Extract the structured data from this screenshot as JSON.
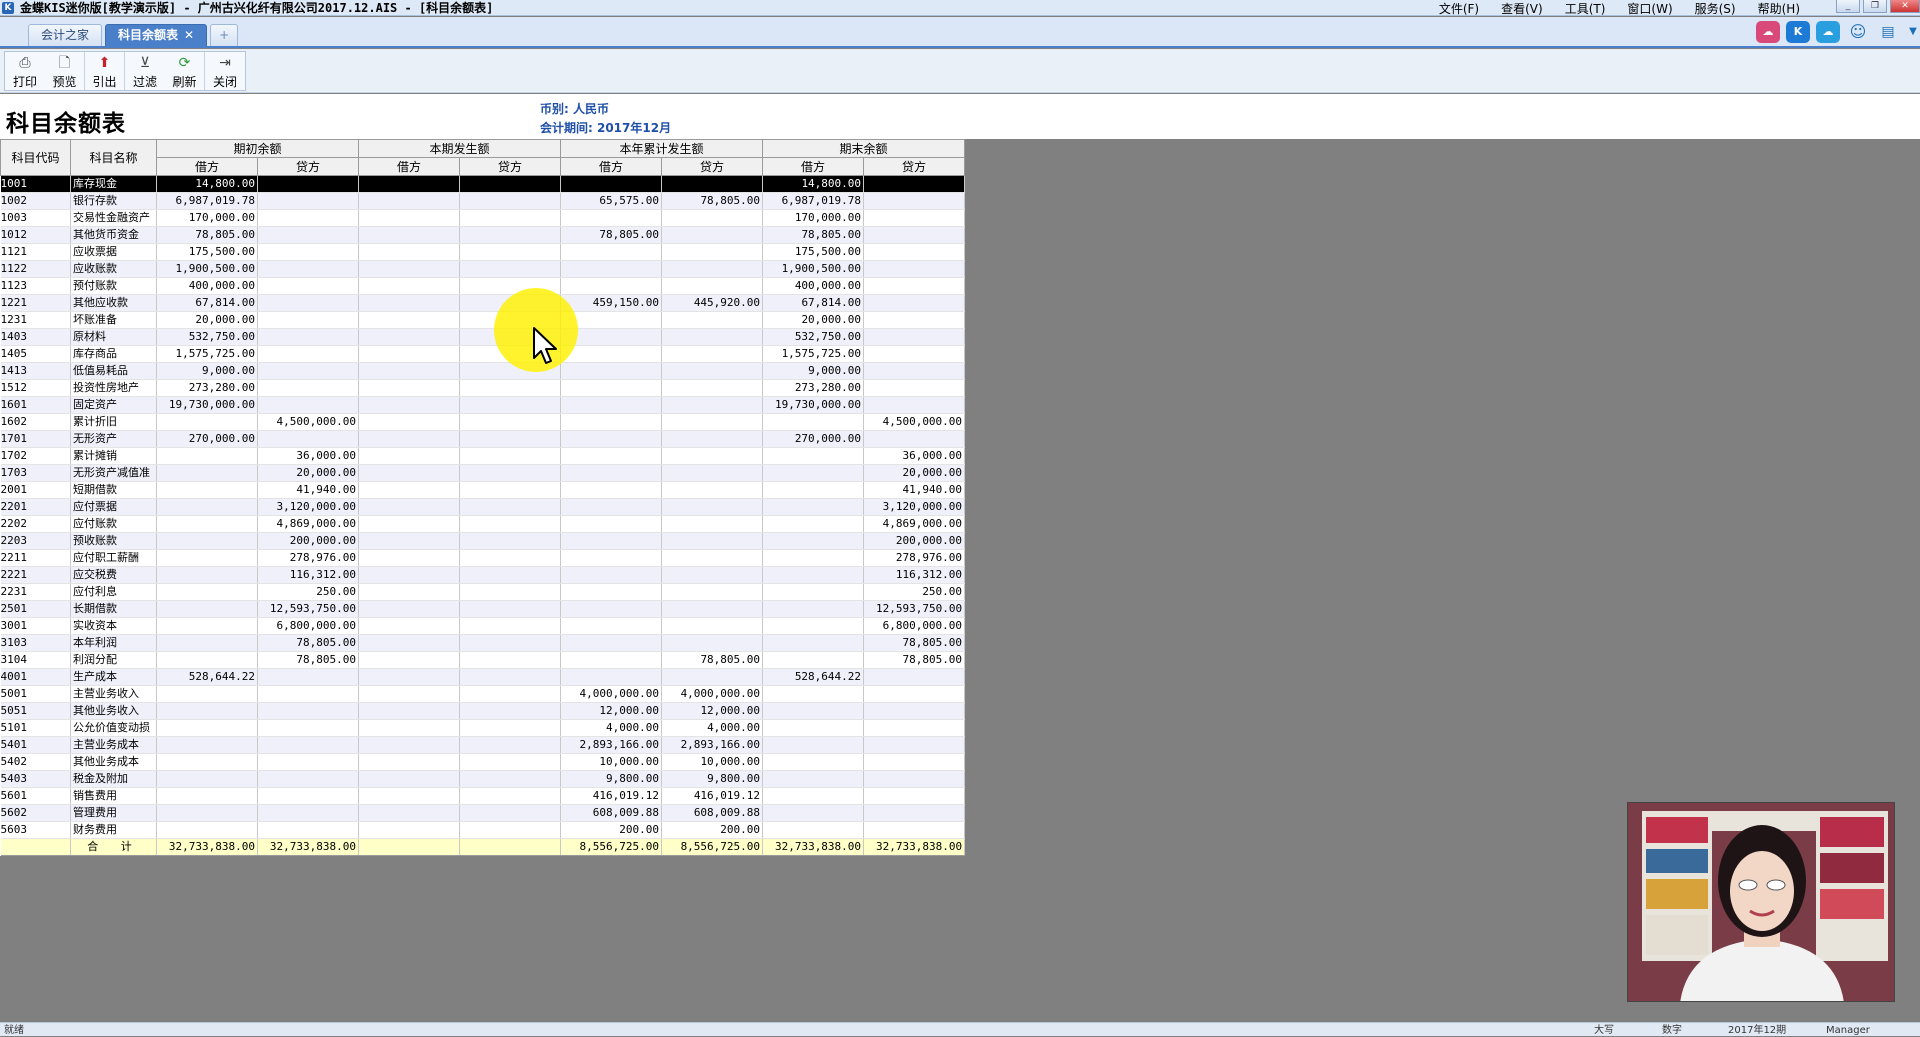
{
  "window": {
    "title": "金蝶KIS迷你版[教学演示版] - 广州古兴化纤有限公司2017.12.AIS - [科目余额表]",
    "menus": [
      "文件(F)",
      "查看(V)",
      "工具(T)",
      "窗口(W)",
      "服务(S)",
      "帮助(H)"
    ]
  },
  "tabs": [
    {
      "label": "会计之家",
      "active": false
    },
    {
      "label": "科目余额表",
      "active": true,
      "close": "✕"
    }
  ],
  "tab_add": "+",
  "toolbar": {
    "print": "打印",
    "preview": "预览",
    "export": "引出",
    "filter": "过滤",
    "refresh": "刷新",
    "close": "关闭"
  },
  "report": {
    "title": "科目余额表",
    "currency": "币别: 人民币",
    "period": "会计期间: 2017年12月"
  },
  "table": {
    "headers": {
      "code": "科目代码",
      "name": "科目名称",
      "opening": "期初余额",
      "current": "本期发生额",
      "ytd": "本年累计发生额",
      "closing": "期末余额",
      "debit": "借方",
      "credit": "贷方"
    },
    "rows": [
      {
        "code": "1001",
        "name": "库存现金",
        "vals": [
          "14,800.00",
          "",
          "",
          "",
          "",
          "",
          "14,800.00",
          ""
        ]
      },
      {
        "code": "1002",
        "name": "银行存款",
        "vals": [
          "6,987,019.78",
          "",
          "",
          "",
          "65,575.00",
          "78,805.00",
          "6,987,019.78",
          ""
        ]
      },
      {
        "code": "1003",
        "name": "交易性金融资产",
        "vals": [
          "170,000.00",
          "",
          "",
          "",
          "",
          "",
          "170,000.00",
          ""
        ]
      },
      {
        "code": "1012",
        "name": "其他货币资金",
        "vals": [
          "78,805.00",
          "",
          "",
          "",
          "78,805.00",
          "",
          "78,805.00",
          ""
        ]
      },
      {
        "code": "1121",
        "name": "应收票据",
        "vals": [
          "175,500.00",
          "",
          "",
          "",
          "",
          "",
          "175,500.00",
          ""
        ]
      },
      {
        "code": "1122",
        "name": "应收账款",
        "vals": [
          "1,900,500.00",
          "",
          "",
          "",
          "",
          "",
          "1,900,500.00",
          ""
        ]
      },
      {
        "code": "1123",
        "name": "预付账款",
        "vals": [
          "400,000.00",
          "",
          "",
          "",
          "",
          "",
          "400,000.00",
          ""
        ]
      },
      {
        "code": "1221",
        "name": "其他应收款",
        "vals": [
          "67,814.00",
          "",
          "",
          "",
          "459,150.00",
          "445,920.00",
          "67,814.00",
          ""
        ]
      },
      {
        "code": "1231",
        "name": "坏账准备",
        "vals": [
          "20,000.00",
          "",
          "",
          "",
          "",
          "",
          "20,000.00",
          ""
        ]
      },
      {
        "code": "1403",
        "name": "原材料",
        "vals": [
          "532,750.00",
          "",
          "",
          "",
          "",
          "",
          "532,750.00",
          ""
        ]
      },
      {
        "code": "1405",
        "name": "库存商品",
        "vals": [
          "1,575,725.00",
          "",
          "",
          "",
          "",
          "",
          "1,575,725.00",
          ""
        ]
      },
      {
        "code": "1413",
        "name": "低值易耗品",
        "vals": [
          "9,000.00",
          "",
          "",
          "",
          "",
          "",
          "9,000.00",
          ""
        ]
      },
      {
        "code": "1512",
        "name": "投资性房地产",
        "vals": [
          "273,280.00",
          "",
          "",
          "",
          "",
          "",
          "273,280.00",
          ""
        ]
      },
      {
        "code": "1601",
        "name": "固定资产",
        "vals": [
          "19,730,000.00",
          "",
          "",
          "",
          "",
          "",
          "19,730,000.00",
          ""
        ]
      },
      {
        "code": "1602",
        "name": "累计折旧",
        "vals": [
          "",
          "4,500,000.00",
          "",
          "",
          "",
          "",
          "",
          "4,500,000.00"
        ]
      },
      {
        "code": "1701",
        "name": "无形资产",
        "vals": [
          "270,000.00",
          "",
          "",
          "",
          "",
          "",
          "270,000.00",
          ""
        ]
      },
      {
        "code": "1702",
        "name": "累计摊销",
        "vals": [
          "",
          "36,000.00",
          "",
          "",
          "",
          "",
          "",
          "36,000.00"
        ]
      },
      {
        "code": "1703",
        "name": "无形资产减值准",
        "vals": [
          "",
          "20,000.00",
          "",
          "",
          "",
          "",
          "",
          "20,000.00"
        ]
      },
      {
        "code": "2001",
        "name": "短期借款",
        "vals": [
          "",
          "41,940.00",
          "",
          "",
          "",
          "",
          "",
          "41,940.00"
        ]
      },
      {
        "code": "2201",
        "name": "应付票据",
        "vals": [
          "",
          "3,120,000.00",
          "",
          "",
          "",
          "",
          "",
          "3,120,000.00"
        ]
      },
      {
        "code": "2202",
        "name": "应付账款",
        "vals": [
          "",
          "4,869,000.00",
          "",
          "",
          "",
          "",
          "",
          "4,869,000.00"
        ]
      },
      {
        "code": "2203",
        "name": "预收账款",
        "vals": [
          "",
          "200,000.00",
          "",
          "",
          "",
          "",
          "",
          "200,000.00"
        ]
      },
      {
        "code": "2211",
        "name": "应付职工薪酬",
        "vals": [
          "",
          "278,976.00",
          "",
          "",
          "",
          "",
          "",
          "278,976.00"
        ]
      },
      {
        "code": "2221",
        "name": "应交税费",
        "vals": [
          "",
          "116,312.00",
          "",
          "",
          "",
          "",
          "",
          "116,312.00"
        ]
      },
      {
        "code": "2231",
        "name": "应付利息",
        "vals": [
          "",
          "250.00",
          "",
          "",
          "",
          "",
          "",
          "250.00"
        ]
      },
      {
        "code": "2501",
        "name": "长期借款",
        "vals": [
          "",
          "12,593,750.00",
          "",
          "",
          "",
          "",
          "",
          "12,593,750.00"
        ]
      },
      {
        "code": "3001",
        "name": "实收资本",
        "vals": [
          "",
          "6,800,000.00",
          "",
          "",
          "",
          "",
          "",
          "6,800,000.00"
        ]
      },
      {
        "code": "3103",
        "name": "本年利润",
        "vals": [
          "",
          "78,805.00",
          "",
          "",
          "",
          "",
          "",
          "78,805.00"
        ]
      },
      {
        "code": "3104",
        "name": "利润分配",
        "vals": [
          "",
          "78,805.00",
          "",
          "",
          "",
          "78,805.00",
          "",
          "78,805.00"
        ]
      },
      {
        "code": "4001",
        "name": "生产成本",
        "vals": [
          "528,644.22",
          "",
          "",
          "",
          "",
          "",
          "528,644.22",
          ""
        ]
      },
      {
        "code": "5001",
        "name": "主营业务收入",
        "vals": [
          "",
          "",
          "",
          "",
          "4,000,000.00",
          "4,000,000.00",
          "",
          ""
        ]
      },
      {
        "code": "5051",
        "name": "其他业务收入",
        "vals": [
          "",
          "",
          "",
          "",
          "12,000.00",
          "12,000.00",
          "",
          ""
        ]
      },
      {
        "code": "5101",
        "name": "公允价值变动损",
        "vals": [
          "",
          "",
          "",
          "",
          "4,000.00",
          "4,000.00",
          "",
          ""
        ]
      },
      {
        "code": "5401",
        "name": "主营业务成本",
        "vals": [
          "",
          "",
          "",
          "",
          "2,893,166.00",
          "2,893,166.00",
          "",
          ""
        ]
      },
      {
        "code": "5402",
        "name": "其他业务成本",
        "vals": [
          "",
          "",
          "",
          "",
          "10,000.00",
          "10,000.00",
          "",
          ""
        ]
      },
      {
        "code": "5403",
        "name": "税金及附加",
        "vals": [
          "",
          "",
          "",
          "",
          "9,800.00",
          "9,800.00",
          "",
          ""
        ]
      },
      {
        "code": "5601",
        "name": "销售费用",
        "vals": [
          "",
          "",
          "",
          "",
          "416,019.12",
          "416,019.12",
          "",
          ""
        ]
      },
      {
        "code": "5602",
        "name": "管理费用",
        "vals": [
          "",
          "",
          "",
          "",
          "608,009.88",
          "608,009.88",
          "",
          ""
        ]
      },
      {
        "code": "5603",
        "name": "财务费用",
        "vals": [
          "",
          "",
          "",
          "",
          "200.00",
          "200.00",
          "",
          ""
        ]
      }
    ],
    "total": {
      "label": "合 计",
      "vals": [
        "32,733,838.00",
        "32,733,838.00",
        "",
        "",
        "8,556,725.00",
        "8,556,725.00",
        "32,733,838.00",
        "32,733,838.00"
      ]
    }
  },
  "statusbar": {
    "left": "就绪",
    "caps": "大写",
    "num": "数字",
    "period": "2017年12期",
    "user": "Manager"
  },
  "colors": {
    "accent": "#4a7fc9",
    "report_label": "#1f4fa8",
    "total_row": "#ffffc8",
    "highlight": "#fff000"
  }
}
